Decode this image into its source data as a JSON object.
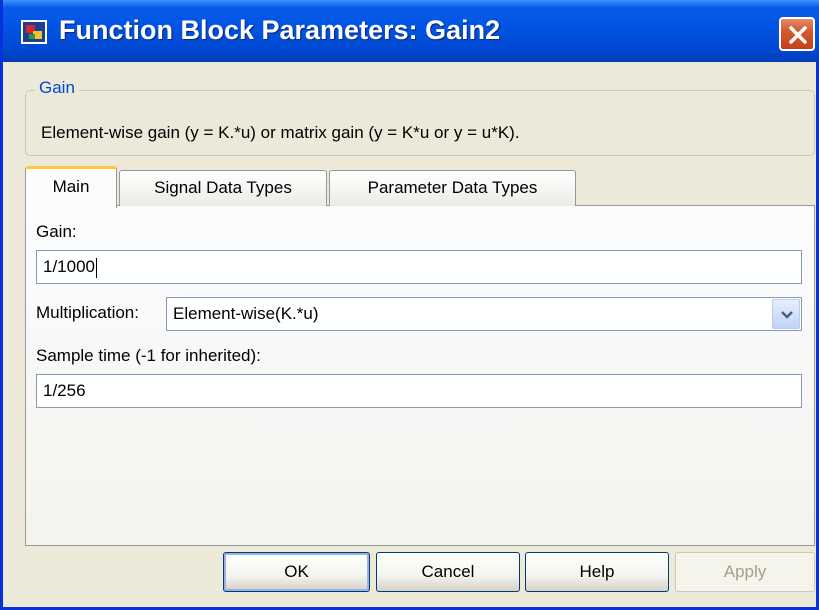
{
  "window": {
    "title": "Function Block Parameters: Gain2"
  },
  "group": {
    "legend": "Gain",
    "description": "Element-wise gain (y = K.*u) or matrix gain (y = K*u or y = u*K)."
  },
  "tabs": [
    {
      "label": "Main",
      "active": true
    },
    {
      "label": "Signal Data Types",
      "active": false
    },
    {
      "label": "Parameter Data Types",
      "active": false
    }
  ],
  "main": {
    "gain_label": "Gain:",
    "gain_value": "1/1000",
    "multiplication_label": "Multiplication:",
    "multiplication_value": "Element-wise(K.*u)",
    "sample_time_label": "Sample time (-1 for inherited):",
    "sample_time_value": "1/256"
  },
  "buttons": {
    "ok": "OK",
    "cancel": "Cancel",
    "help": "Help",
    "apply": "Apply"
  },
  "colors": {
    "title_bar": "#0054e3",
    "close_button": "#c4411a",
    "group_legend": "#0046d5",
    "active_tab_accent": "#ffc83c"
  }
}
